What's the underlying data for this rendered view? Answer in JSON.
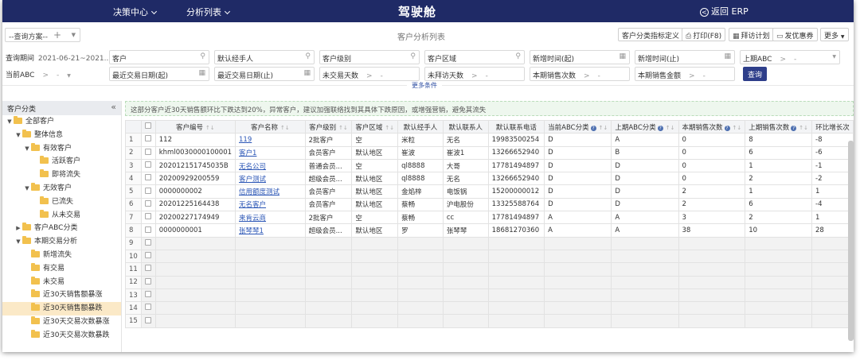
{
  "nav": {
    "decision_center": "决策中心",
    "analysis_list": "分析列表",
    "title": "驾驶舱",
    "back_erp": "返回 ERP"
  },
  "toolbar": {
    "scheme_placeholder": "--查询方案--",
    "page_title": "客户分析列表",
    "btn_indicator": "客户分类指标定义",
    "btn_print": "打印(F8)",
    "btn_visit": "拜访计划",
    "btn_coupon": "发优惠券",
    "btn_more": "更多"
  },
  "filters": {
    "row1": {
      "period_label": "查询期间",
      "period_value": "2021-06-21~2021...",
      "customer": "客户",
      "default_manager": "默认经手人",
      "customer_level": "客户级别",
      "customer_area": "客户区域",
      "new_time_start": "新增时间(起)",
      "new_time_end": "新增时间(止)",
      "last_abc": "上期ABC"
    },
    "row2": {
      "current_abc": "当前ABC",
      "last_trade_start": "最近交易日期(起)",
      "last_trade_end": "最近交易日期(止)",
      "no_trade_days": "未交易天数",
      "no_visit_days": "未拜访天数",
      "sales_count": "本期销售次数",
      "sales_amount": "本期销售金额",
      "query": "查询"
    },
    "range_sep": ">",
    "range_dash": "-",
    "more_conditions": "更多条件"
  },
  "sidebar": {
    "header": "客户分类",
    "collapse": "«",
    "items": [
      {
        "label": "全部客户",
        "level": 0,
        "expand": "down",
        "selected": false
      },
      {
        "label": "整体信息",
        "level": 1,
        "expand": "down",
        "selected": false
      },
      {
        "label": "有效客户",
        "level": 2,
        "expand": "down",
        "selected": false
      },
      {
        "label": "活跃客户",
        "level": 3,
        "expand": "",
        "selected": false
      },
      {
        "label": "即将流失",
        "level": 3,
        "expand": "",
        "selected": false
      },
      {
        "label": "无效客户",
        "level": 2,
        "expand": "down",
        "selected": false
      },
      {
        "label": "已流失",
        "level": 3,
        "expand": "",
        "selected": false
      },
      {
        "label": "从未交易",
        "level": 3,
        "expand": "",
        "selected": false
      },
      {
        "label": "客户ABC分类",
        "level": 1,
        "expand": "right",
        "selected": false
      },
      {
        "label": "本期交易分析",
        "level": 1,
        "expand": "down",
        "selected": false
      },
      {
        "label": "新增流失",
        "level": 2,
        "expand": "",
        "selected": false
      },
      {
        "label": "有交易",
        "level": 2,
        "expand": "",
        "selected": false
      },
      {
        "label": "未交易",
        "level": 2,
        "expand": "",
        "selected": false
      },
      {
        "label": "近30天销售额暴涨",
        "level": 2,
        "expand": "",
        "selected": false
      },
      {
        "label": "近30天销售额暴跌",
        "level": 2,
        "expand": "",
        "selected": true
      },
      {
        "label": "近30天交易次数暴涨",
        "level": 2,
        "expand": "",
        "selected": false
      },
      {
        "label": "近30天交易次数暴跌",
        "level": 2,
        "expand": "",
        "selected": false
      }
    ]
  },
  "notice": "这部分客户近30天销售额环比下跌达到20%，异常客户，建议加强联络找到其具体下跌原因，或增强营销，避免其流失",
  "table": {
    "headers": [
      "",
      "",
      "客户编号",
      "客户名称",
      "客户级别",
      "客户区域",
      "默认经手人",
      "默认联系人",
      "默认联系电话",
      "当前ABC分类",
      "上期ABC分类",
      "本期销售次数",
      "上期销售次数",
      "环比增长次"
    ],
    "rows": [
      [
        "1",
        "112",
        "119",
        "2批客户",
        "空",
        "米粒",
        "无名",
        "19983500254",
        "D",
        "A",
        "0",
        "8",
        "-8"
      ],
      [
        "2",
        "khml0030000100001",
        "客户1",
        "会员客户",
        "默认地区",
        "崔波",
        "崔波1",
        "13266652940",
        "D",
        "B",
        "0",
        "6",
        "-6"
      ],
      [
        "3",
        "202012151745035B",
        "无名公司",
        "普通会员...",
        "空",
        "ql8888",
        "大哥",
        "17781494897",
        "D",
        "D",
        "0",
        "1",
        "-1"
      ],
      [
        "4",
        "20200929200559",
        "客户测试",
        "超级会员...",
        "默认地区",
        "ql8888",
        "无名",
        "13266652940",
        "D",
        "D",
        "0",
        "2",
        "-2"
      ],
      [
        "5",
        "0000000002",
        "信用额度测试",
        "会员客户",
        "默认地区",
        "金焰梓",
        "电饭锅",
        "15200000012",
        "D",
        "D",
        "2",
        "1",
        "1"
      ],
      [
        "6",
        "20201225164438",
        "无名客户",
        "会员客户",
        "默认地区",
        "蔡畅",
        "沪电股份",
        "13325588764",
        "D",
        "D",
        "2",
        "6",
        "-4"
      ],
      [
        "7",
        "20200227174949",
        "来肯云商",
        "2批客户",
        "空",
        "蔡畅",
        "cc",
        "17781494897",
        "A",
        "A",
        "3",
        "2",
        "1"
      ],
      [
        "8",
        "0000000001",
        "张琴琴1",
        "超级会员...",
        "默认地区",
        "罗",
        "张琴琴",
        "18681270360",
        "A",
        "A",
        "38",
        "10",
        "28"
      ]
    ],
    "empty_rows": [
      "9",
      "10",
      "11",
      "12",
      "13",
      "14",
      "15"
    ]
  },
  "colors": {
    "nav_bg": "#1f2a66",
    "query_btn": "#2e3e8a",
    "link": "#2a55b5",
    "selected_bg": "#fbe9c7",
    "folder": "#f2c14e"
  },
  "icons": [
    "chevron-down-icon",
    "back-circle-icon",
    "plus-icon",
    "print-icon",
    "calendar-icon",
    "coupon-icon",
    "search-icon",
    "folder-icon",
    "help-icon",
    "sort-icon"
  ]
}
